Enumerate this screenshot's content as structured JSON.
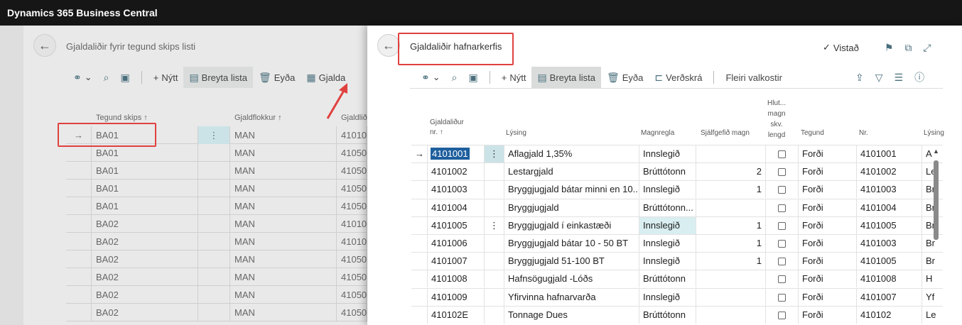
{
  "app": {
    "title": "Dynamics 365 Business Central"
  },
  "background_page": {
    "title": "Gjaldaliðir fyrir tegund skips listi",
    "toolbar": {
      "new": "Nýtt",
      "edit_list": "Breyta lista",
      "delete": "Eyða",
      "charges": "Gjalda"
    },
    "columns": [
      "Tegund skips ↑",
      "Gjaldflokkur ↑",
      "Gjaldlið"
    ],
    "rows": [
      {
        "type": "BA01",
        "group": "MAN",
        "code": "41010"
      },
      {
        "type": "BA01",
        "group": "MAN",
        "code": "41050"
      },
      {
        "type": "BA01",
        "group": "MAN",
        "code": "41050"
      },
      {
        "type": "BA01",
        "group": "MAN",
        "code": "41050"
      },
      {
        "type": "BA01",
        "group": "MAN",
        "code": "41050"
      },
      {
        "type": "BA02",
        "group": "MAN",
        "code": "41010"
      },
      {
        "type": "BA02",
        "group": "MAN",
        "code": "41010"
      },
      {
        "type": "BA02",
        "group": "MAN",
        "code": "41050"
      },
      {
        "type": "BA02",
        "group": "MAN",
        "code": "41050"
      },
      {
        "type": "BA02",
        "group": "MAN",
        "code": "41050"
      },
      {
        "type": "BA02",
        "group": "MAN",
        "code": "41050"
      }
    ]
  },
  "panel": {
    "title": "Gjaldaliðir hafnarkerfis",
    "saved": "Vistað",
    "toolbar": {
      "new": "Nýtt",
      "edit_list": "Breyta lista",
      "delete": "Eyða",
      "price_list": "Verðskrá",
      "more": "Fleiri valkostir"
    },
    "columns": {
      "code_l1": "Gjaldaliður",
      "code_l2": "nr. ↑",
      "desc": "Lýsing",
      "rule": "Magnregla",
      "default_qty": "Sjálfgefið magn",
      "ratio_l1": "Hlut...",
      "ratio_l2": "magn",
      "ratio_l3": "skv.",
      "ratio_l4": "lengd",
      "kind": "Tegund",
      "nr": "Nr.",
      "desc2": "Lýsing"
    },
    "rows": [
      {
        "code": "4101001",
        "desc": "Aflagjald 1,35%",
        "rule": "Innslegið",
        "qty": "",
        "kind": "Forði",
        "nr": "4101001",
        "d2": "A"
      },
      {
        "code": "4101002",
        "desc": "Lestargjald",
        "rule": "Brúttótonn",
        "qty": "2",
        "kind": "Forði",
        "nr": "4101002",
        "d2": "Le"
      },
      {
        "code": "4101003",
        "desc": "Bryggjugjald bátar minni en 10...",
        "rule": "Innslegið",
        "qty": "1",
        "kind": "Forði",
        "nr": "4101003",
        "d2": "Br"
      },
      {
        "code": "4101004",
        "desc": "Bryggjugjald",
        "rule": "Brúttótonn...",
        "qty": "",
        "kind": "Forði",
        "nr": "4101004",
        "d2": "Br"
      },
      {
        "code": "4101005",
        "desc": "Bryggjugjald í einkastæði",
        "rule": "Innslegið",
        "qty": "1",
        "kind": "Forði",
        "nr": "4101005",
        "d2": "Br"
      },
      {
        "code": "4101006",
        "desc": "Bryggjugjald  bátar 10 - 50 BT",
        "rule": "Innslegið",
        "qty": "1",
        "kind": "Forði",
        "nr": "4101003",
        "d2": "Br"
      },
      {
        "code": "4101007",
        "desc": "Bryggjugjald 51-100 BT",
        "rule": "Innslegið",
        "qty": "1",
        "kind": "Forði",
        "nr": "4101005",
        "d2": "Br"
      },
      {
        "code": "4101008",
        "desc": "Hafnsögugjald -Lóðs",
        "rule": "Brúttótonn",
        "qty": "",
        "kind": "Forði",
        "nr": "4101008",
        "d2": "H"
      },
      {
        "code": "4101009",
        "desc": "Yfirvinna hafnarvarða",
        "rule": "Innslegið",
        "qty": "",
        "kind": "Forði",
        "nr": "4101007",
        "d2": "Yf"
      },
      {
        "code": "410102E",
        "desc": "Tonnage Dues",
        "rule": "Brúttótonn",
        "qty": "",
        "kind": "Forði",
        "nr": "410102",
        "d2": "Le"
      }
    ]
  }
}
